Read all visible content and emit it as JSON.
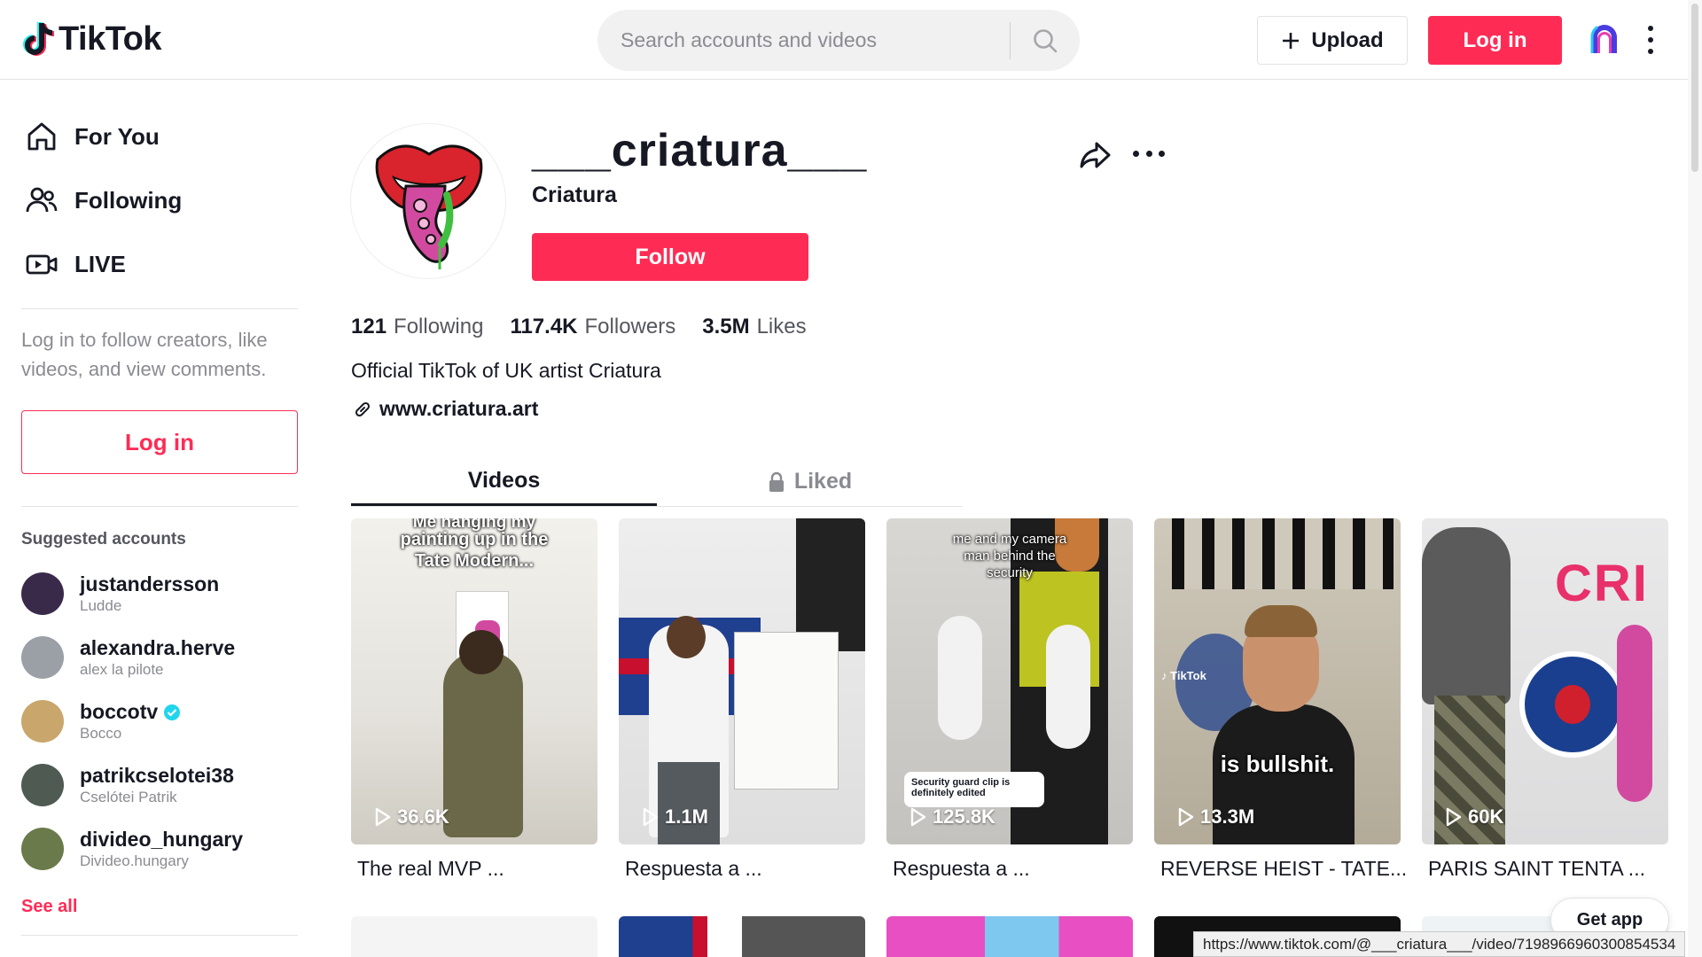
{
  "header": {
    "logo_text": "TikTok",
    "search_placeholder": "Search accounts and videos",
    "upload_label": "Upload",
    "login_label": "Log in",
    "icons": [
      "tiktok-logo-icon",
      "search-icon",
      "plus-icon",
      "brand-arch-icon",
      "more-vertical-icon"
    ]
  },
  "sidebar": {
    "nav": [
      {
        "label": "For You",
        "icon": "home-icon"
      },
      {
        "label": "Following",
        "icon": "following-icon"
      },
      {
        "label": "LIVE",
        "icon": "live-icon"
      }
    ],
    "login_prompt": "Log in to follow creators, like videos, and view comments.",
    "login_label": "Log in",
    "suggested_title": "Suggested accounts",
    "accounts": [
      {
        "name": "justandersson",
        "sub": "Ludde",
        "verified": false,
        "color": "#3a2a4a"
      },
      {
        "name": "alexandra.herve",
        "sub": "alex la pilote",
        "verified": false,
        "color": "#9aa0a6"
      },
      {
        "name": "boccotv",
        "sub": "Bocco",
        "verified": true,
        "color": "#c9a66b"
      },
      {
        "name": "patrikcselotei38",
        "sub": "Cselótei Patrik",
        "verified": false,
        "color": "#4e5a52"
      },
      {
        "name": "divideo_hungary",
        "sub": "Divideo.hungary",
        "verified": false,
        "color": "#6b7a4a"
      }
    ],
    "see_all": "See all"
  },
  "profile": {
    "username": "___criatura___",
    "nickname": "Criatura",
    "follow_label": "Follow",
    "stats": [
      {
        "num": "121",
        "label": "Following"
      },
      {
        "num": "117.4K",
        "label": "Followers"
      },
      {
        "num": "3.5M",
        "label": "Likes"
      }
    ],
    "bio": "Official TikTok of UK artist Criatura",
    "link": "www.criatura.art"
  },
  "tabs": {
    "videos": "Videos",
    "liked": "Liked"
  },
  "videos": [
    {
      "views": "36.6K",
      "caption": "The real MVP ...",
      "overlay": "painting up in the Tate Modern...",
      "overlay_top": "Me hanging my"
    },
    {
      "views": "1.1M",
      "caption": "Respuesta a ...",
      "overlay": ""
    },
    {
      "views": "125.8K",
      "caption": "Respuesta a ...",
      "overlay": "me and my camera man behind the security",
      "badge": "Security guard clip is definitely edited"
    },
    {
      "views": "13.3M",
      "caption": "REVERSE HEIST - TATE...",
      "overlay": "is bullshit.",
      "watermark": "TikTok"
    },
    {
      "views": "60K",
      "caption": "PARIS SAINT TENTA ...",
      "overlay": "CRI"
    }
  ],
  "get_app": "Get app",
  "status_url": "https://www.tiktok.com/@___criatura___/video/7198966960300854534"
}
